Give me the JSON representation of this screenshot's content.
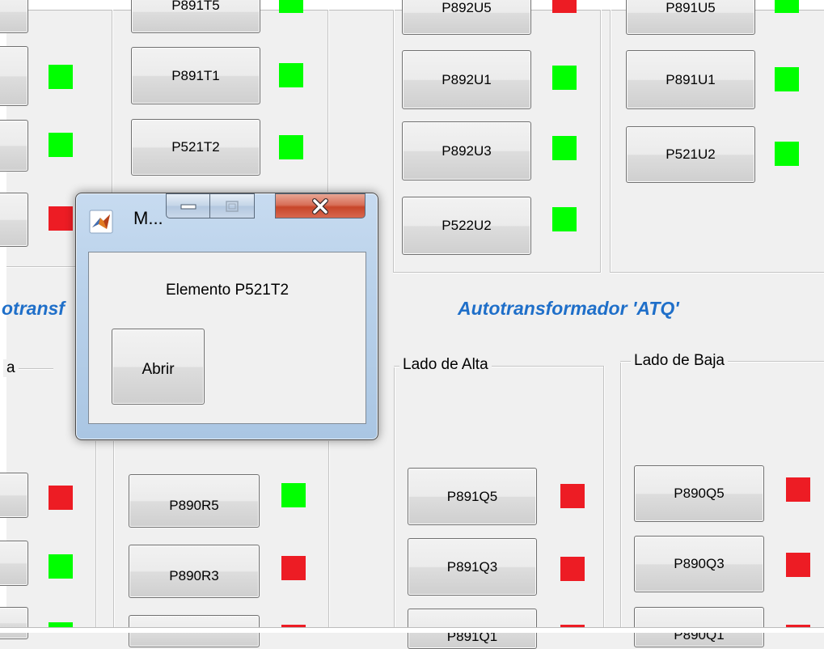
{
  "colors": {
    "on": "#00ff00",
    "off": "#ed1c24",
    "title_blue": "#1f6fc9"
  },
  "background": {
    "top_row": [
      {
        "label": "P891T5",
        "state": "on"
      },
      {
        "label": "P892U5",
        "state": "off"
      },
      {
        "label": "P891U5",
        "state": "on"
      }
    ],
    "left_col_indicators": [
      "on",
      "on",
      "off"
    ],
    "t_buttons": [
      {
        "label": "P891T1",
        "state": "on"
      },
      {
        "label": "P521T2",
        "state": "on"
      }
    ],
    "u_left_buttons": [
      {
        "label": "P892U1",
        "state": "on"
      },
      {
        "label": "P892U3",
        "state": "on"
      },
      {
        "label": "P522U2",
        "state": "on"
      }
    ],
    "u_right_buttons": [
      {
        "label": "P891U1",
        "state": "on"
      },
      {
        "label": "P521U2",
        "state": "on"
      }
    ],
    "left_title_partial": "otransf",
    "atq_title": "Autotransformador 'ATQ'",
    "lado_alta": "Lado de Alta",
    "lado_baja": "Lado de Baja",
    "left_group_partial": "a",
    "lower_left_indicators": [
      "off",
      "on",
      "on"
    ],
    "r_buttons": [
      {
        "label": "P890R5",
        "state": "on"
      },
      {
        "label": "P890R3",
        "state": "off"
      }
    ],
    "q_alta_buttons": [
      {
        "label": "P891Q5",
        "state": "off"
      },
      {
        "label": "P891Q3",
        "state": "off"
      },
      {
        "label": "P891Q1",
        "state": "off"
      }
    ],
    "q_baja_buttons": [
      {
        "label": "P890Q5",
        "state": "off"
      },
      {
        "label": "P890Q3",
        "state": "off"
      },
      {
        "label": "P890Q1",
        "state": "off"
      }
    ]
  },
  "dialog": {
    "title": "M...",
    "message": "Elemento P521T2",
    "open_button": "Abrir",
    "icons": {
      "app": "matlab-icon",
      "minimize": "minimize-icon",
      "maximize": "maximize-icon",
      "close": "close-icon"
    }
  }
}
